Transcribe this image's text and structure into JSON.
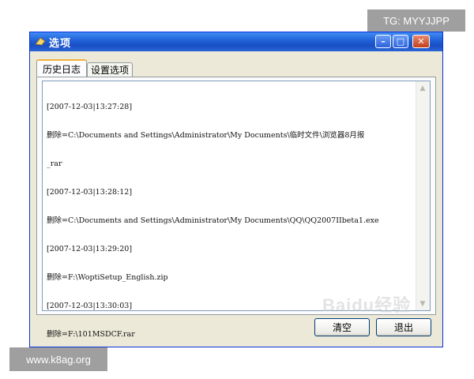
{
  "badges": {
    "tg": "TG: MYYJJPP",
    "site": "www.k8ag.org"
  },
  "window": {
    "title": "选项",
    "controls": {
      "minimize": "–",
      "maximize": "□",
      "close": "✕"
    }
  },
  "tabs": [
    {
      "label": "历史日志",
      "active": true
    },
    {
      "label": "设置选项",
      "active": false
    }
  ],
  "log": {
    "lines": [
      "[2007-12-03|13:27:28]",
      "删除=C:\\Documents and Settings\\Administrator\\My Documents\\临时文件\\浏览器8月报",
      "_rar",
      "[2007-12-03|13:28:12]",
      "删除=C:\\Documents and Settings\\Administrator\\My Documents\\QQ\\QQ2007IIbeta1.exe",
      "[2007-12-03|13:29:20]",
      "删除=F:\\WoptiSetup_English.zip",
      "[2007-12-03|13:30:03]",
      "删除=F:\\101MSDCF.rar"
    ]
  },
  "buttons": {
    "clear": "清空",
    "exit": "退出"
  },
  "watermark": "Baidu经验"
}
